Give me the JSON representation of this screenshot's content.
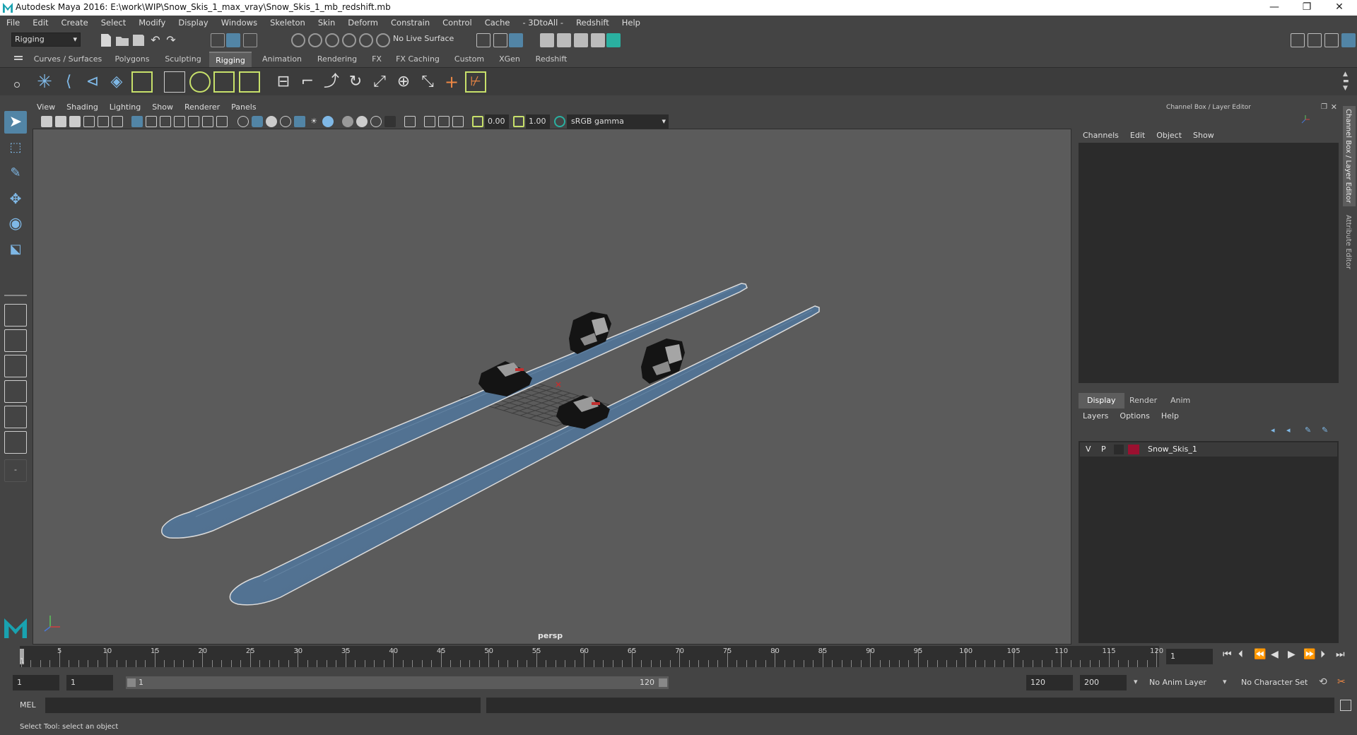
{
  "window": {
    "title": "Autodesk Maya 2016: E:\\work\\WIP\\Snow_Skis_1_max_vray\\Snow_Skis_1_mb_redshift.mb",
    "minimize": "—",
    "maximize": "❐",
    "close": "✕"
  },
  "menubar": [
    "File",
    "Edit",
    "Create",
    "Select",
    "Modify",
    "Display",
    "Windows",
    "Skeleton",
    "Skin",
    "Deform",
    "Constrain",
    "Control",
    "Cache",
    "- 3DtoAll -",
    "Redshift",
    "Help"
  ],
  "statusline": {
    "mode": "Rigging",
    "live_surface": "No Live Surface"
  },
  "shelf_tabs": [
    "Curves / Surfaces",
    "Polygons",
    "Sculpting",
    "Rigging",
    "Animation",
    "Rendering",
    "FX",
    "FX Caching",
    "Custom",
    "XGen",
    "Redshift"
  ],
  "shelf_active": "Rigging",
  "viewport": {
    "menu": [
      "View",
      "Shading",
      "Lighting",
      "Show",
      "Renderer",
      "Panels"
    ],
    "exposure": "0.00",
    "gamma": "1.00",
    "color_space": "sRGB gamma",
    "camera_label": "persp"
  },
  "channel_box": {
    "header": "Channel Box / Layer Editor",
    "menu": [
      "Channels",
      "Edit",
      "Object",
      "Show"
    ]
  },
  "layer_editor": {
    "tabs": [
      "Display",
      "Render",
      "Anim"
    ],
    "active_tab": "Display",
    "menu": [
      "Layers",
      "Options",
      "Help"
    ],
    "layers": [
      {
        "v": "V",
        "p": "P",
        "name": "Snow_Skis_1",
        "color": "#9b1030"
      }
    ]
  },
  "side_tabs": [
    "Channel Box / Layer Editor",
    "Attribute Editor"
  ],
  "time_slider": {
    "ticks": [
      "5",
      "10",
      "15",
      "20",
      "25",
      "30",
      "35",
      "40",
      "45",
      "50",
      "55",
      "60",
      "65",
      "70",
      "75",
      "80",
      "85",
      "90",
      "95",
      "100",
      "105",
      "110",
      "115",
      "120"
    ],
    "start_label": "1",
    "current_frame": "1"
  },
  "range": {
    "start": "1",
    "playback_start": "1",
    "range_start_label": "1",
    "range_end_label": "120",
    "playback_end": "120",
    "end": "200",
    "anim_layer": "No Anim Layer",
    "character_set": "No Character Set"
  },
  "command_line": {
    "label": "MEL"
  },
  "help_line": "Select Tool: select an object",
  "colors": {
    "accent": "#5285a6",
    "ski_base": "#4f6f8e",
    "layer_color": "#9b1030"
  }
}
